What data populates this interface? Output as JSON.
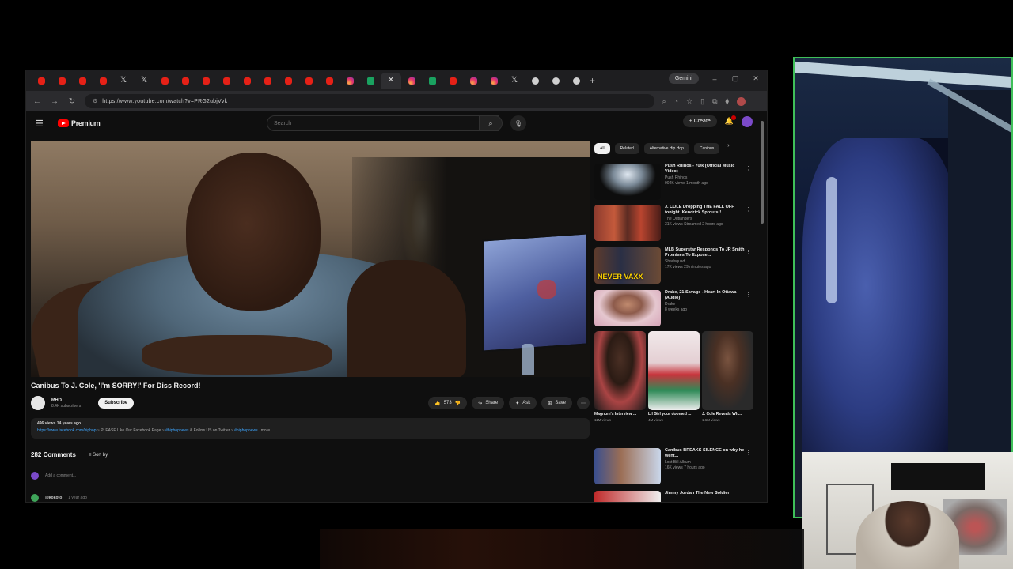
{
  "browser": {
    "tabs": [
      "yt",
      "yt",
      "yt",
      "yt",
      "x",
      "x",
      "yt",
      "yt",
      "yt",
      "yt",
      "yt",
      "yt",
      "yt",
      "yt",
      "yt",
      "ig",
      "xl",
      "active",
      "ig",
      "xl",
      "yt",
      "ig",
      "ig",
      "x",
      "gr",
      "gr",
      "gr"
    ],
    "new_tab": "+",
    "gemini_label": "Gemini",
    "url": "https://www.youtube.com/watch?v=PRG2ubjVvk"
  },
  "youtube": {
    "logo": "Premium",
    "search_placeholder": "Search",
    "create_label": "+ Create",
    "video_title": "Canibus To J. Cole, 'I'm SORRY!' For Diss Record!",
    "channel_name": "RHD",
    "channel_subs": "8.4K subscribers",
    "subscribe_label": "Subscribe",
    "actions": {
      "likes": "573",
      "share": "Share",
      "ask": "Ask",
      "save": "Save"
    },
    "description": {
      "meta": "496 views  14 years ago",
      "link": "https://www.facebook.com/hiphop",
      "text": " ~ PLEASE Like Our Facebook Page ~ ",
      "text2": " & Follow US on Twitter ~ ",
      "more": "...more"
    },
    "comments_count": "282 Comments",
    "sort_by": "Sort by",
    "add_comment": "Add a comment...",
    "first_commenter": "@kokoto",
    "first_comment_time": "1 year ago"
  },
  "sidebar": {
    "chips": [
      "All",
      "Related",
      "Alternative Hip Hop",
      "Canibus"
    ],
    "recs": [
      {
        "title": "Push Rhinos - 70/k (Official Music Video)",
        "channel": "Push Rhinos",
        "meta": "904K views  1 month ago"
      },
      {
        "title": "J. COLE Dropping THE FALL OFF tonight. Kendrick Sprouts!!",
        "channel": "The Outlanders",
        "meta": "31K views  Streamed 2 hours ago"
      },
      {
        "title": "MLB Superstar Responds To JR Smith Promises To Expose...",
        "channel": "Shadsquad",
        "meta": "17K views  29 minutes ago"
      },
      {
        "title": "Drake, 21 Savage - Heart In Ottawa (Audio)",
        "channel": "Drake",
        "meta": "8 weeks ago"
      }
    ],
    "shorts": [
      {
        "title": "Magnum's Interview ...",
        "views": "11M views"
      },
      {
        "title": "Lil Girl your doomed ...",
        "views": "4M views"
      },
      {
        "title": "J. Cole Reveals Wh...",
        "views": "1.6M views"
      }
    ],
    "rec_last": {
      "title": "Canibus BREAKS SILENCE on why he went...",
      "channel": "Lost Bill Album",
      "meta": "16K views  7 hours ago"
    },
    "rec_last2": {
      "title": "Jimmy Jordan The New Soldier"
    }
  }
}
